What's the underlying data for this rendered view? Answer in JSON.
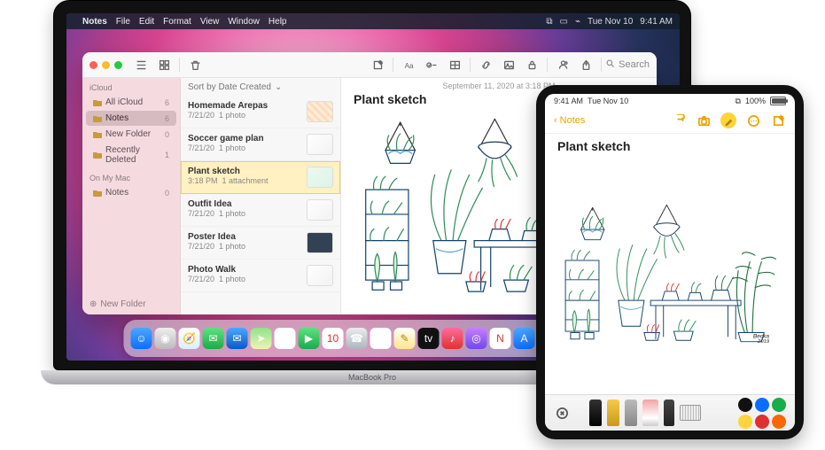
{
  "menubar": {
    "apple": "",
    "app": "Notes",
    "items": [
      "File",
      "Edit",
      "Format",
      "View",
      "Window",
      "Help"
    ],
    "date": "Tue Nov 10",
    "time": "9:41 AM"
  },
  "window": {
    "search_placeholder": "Search"
  },
  "sidebar": {
    "sections": [
      {
        "label": "iCloud",
        "items": [
          {
            "label": "All iCloud",
            "count": "6"
          },
          {
            "label": "Notes",
            "count": "6",
            "selected": true
          },
          {
            "label": "New Folder",
            "count": "0"
          },
          {
            "label": "Recently Deleted",
            "count": "1"
          }
        ]
      },
      {
        "label": "On My Mac",
        "items": [
          {
            "label": "Notes",
            "count": "0"
          }
        ]
      }
    ],
    "new_folder": "New Folder"
  },
  "notes_list": {
    "sort_label": "Sort by Date Created",
    "items": [
      {
        "title": "Homemade Arepas",
        "date": "7/21/20",
        "sub": "1 photo",
        "thumb": "stripes"
      },
      {
        "title": "Soccer game plan",
        "date": "7/21/20",
        "sub": "1 photo",
        "thumb": "plain"
      },
      {
        "title": "Plant sketch",
        "date": "3:18 PM",
        "sub": "1 attachment",
        "thumb": "sketch",
        "selected": true
      },
      {
        "title": "Outfit Idea",
        "date": "7/21/20",
        "sub": "1 photo",
        "thumb": "plain"
      },
      {
        "title": "Poster Idea",
        "date": "7/21/20",
        "sub": "1 photo",
        "thumb": "dark"
      },
      {
        "title": "Photo Walk",
        "date": "7/21/20",
        "sub": "1 photo",
        "thumb": "plain"
      }
    ]
  },
  "editor": {
    "date": "September 11, 2020 at 3:18 PM",
    "title": "Plant sketch",
    "signature": "Becka\n2019"
  },
  "hinge_label": "MacBook Pro",
  "dock": {
    "items": [
      {
        "name": "finder",
        "bg": "linear-gradient(#4aa7ff,#0d6efd)",
        "glyph": "☺"
      },
      {
        "name": "launchpad",
        "bg": "linear-gradient(#eee,#bbb)",
        "glyph": "◉"
      },
      {
        "name": "safari",
        "bg": "linear-gradient(#fff,#dbeeff)",
        "glyph": "🧭"
      },
      {
        "name": "messages",
        "bg": "linear-gradient(#5ce27f,#1aab4a)",
        "glyph": "✉"
      },
      {
        "name": "mail",
        "bg": "linear-gradient(#4aa7ff,#0a58ca)",
        "glyph": "✉"
      },
      {
        "name": "maps",
        "bg": "linear-gradient(#8fe388,#eef4b6)",
        "glyph": "➤"
      },
      {
        "name": "photos",
        "bg": "#fff",
        "glyph": "✿"
      },
      {
        "name": "facetime",
        "bg": "linear-gradient(#5ce27f,#1aab4a)",
        "glyph": "▶"
      },
      {
        "name": "calendar",
        "bg": "#fff",
        "glyph": "10",
        "text": "#e03131"
      },
      {
        "name": "contacts",
        "bg": "linear-gradient(#e9ecef,#adb5bd)",
        "glyph": "☎"
      },
      {
        "name": "reminders",
        "bg": "#fff",
        "glyph": "≡"
      },
      {
        "name": "notes",
        "bg": "linear-gradient(#fff,#ffe58a)",
        "glyph": "✎",
        "text": "#b38600"
      },
      {
        "name": "tv",
        "bg": "#111",
        "glyph": "tv",
        "text": "#fff"
      },
      {
        "name": "music",
        "bg": "linear-gradient(#ff6b9d,#e03131)",
        "glyph": "♪"
      },
      {
        "name": "podcasts",
        "bg": "linear-gradient(#c77dff,#7048e8)",
        "glyph": "◎"
      },
      {
        "name": "news",
        "bg": "#fff",
        "glyph": "N",
        "text": "#e03131"
      },
      {
        "name": "appstore",
        "bg": "linear-gradient(#4aa7ff,#0d6efd)",
        "glyph": "A"
      },
      {
        "name": "settings",
        "bg": "linear-gradient(#e9ecef,#868e96)",
        "glyph": "⚙"
      }
    ],
    "right": [
      {
        "name": "downloads",
        "bg": "linear-gradient(#5ce27f,#1aab4a)",
        "glyph": "⬇"
      },
      {
        "name": "trash",
        "bg": "linear-gradient(#e9ecef,#adb5bd)",
        "glyph": "🗑"
      }
    ]
  },
  "ipad": {
    "time": "9:41 AM",
    "date": "Tue Nov 10",
    "battery_pct": "100%",
    "back_label": "Notes",
    "title": "Plant sketch",
    "palette": [
      "#111111",
      "#0d6efd",
      "#1aab4a",
      "#ffd43b",
      "#e03131",
      "#f76707"
    ]
  }
}
